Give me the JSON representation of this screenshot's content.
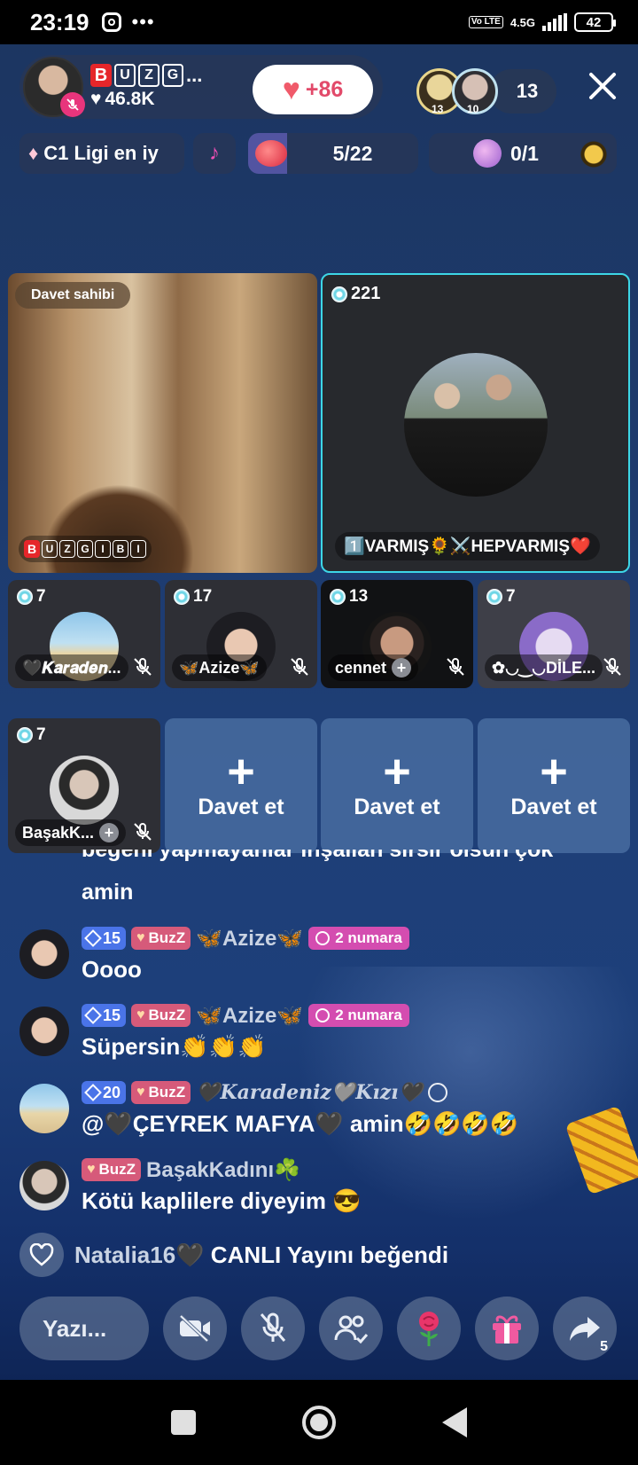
{
  "status_bar": {
    "time": "23:19",
    "network": "4.5G",
    "volte": "Vo LTE",
    "battery": "42"
  },
  "header": {
    "host_letters": [
      "B",
      "U",
      "Z",
      "G"
    ],
    "host_name_ellipsis": "...",
    "host_likes": "46.8K",
    "likes_delta": "+86",
    "viewer_ranks": [
      "13",
      "10"
    ],
    "viewer_count": "13",
    "league": "C1 Ligi en iy",
    "goal_progress": "5/22",
    "goal_fraction": 0.227,
    "box_progress": "0/1"
  },
  "grid": {
    "host_label": "Davet sahibi",
    "host_tile_letters": [
      "B",
      "U",
      "Z",
      "G",
      "I",
      "B",
      "I"
    ],
    "main_guest": {
      "coins": "221",
      "name": "1️⃣VARMIŞ🌻⚔️HEPVARMIŞ❤️"
    },
    "guests": [
      {
        "coins": "7",
        "name": "🖤𝑲𝒂𝒓𝒂𝒅𝒆𝒏..."
      },
      {
        "coins": "17",
        "name": "🦋Azize🦋"
      },
      {
        "coins": "13",
        "name": "cennet"
      },
      {
        "coins": "7",
        "name": "✿◡‿◡DİLE..."
      },
      {
        "coins": "7",
        "name": "BaşakK..."
      }
    ],
    "invite_label": "Davet et",
    "invite_plus": "+"
  },
  "chat": {
    "partial_line": "beğeni yapmayanlar inşallah sirsir olsun çok",
    "partial_line2": "amin",
    "messages": [
      {
        "level": "15",
        "buzz": "BuzZ",
        "user": "🦋Azize🦋",
        "rank": "2 numara",
        "text": "Oooo"
      },
      {
        "level": "15",
        "buzz": "BuzZ",
        "user": "🦋Azize🦋",
        "rank": "2 numara",
        "text": "Süpersin👏👏👏"
      },
      {
        "level": "20",
        "buzz": "BuzZ",
        "user": "🖤Karadeniz🩶Kızı🖤",
        "text": "@🖤ÇEYREK MAFYA🖤 amin🤣🤣🤣🤣"
      },
      {
        "buzz": "BuzZ",
        "user": "BaşakKadını☘️",
        "text": "Kötü kaplilere diyeyim 😎"
      }
    ],
    "liked_user": "Natalia16🖤",
    "liked_text": "CANLI Yayını beğendi"
  },
  "bottom_bar": {
    "input_placeholder": "Yazı...",
    "share_count": "5"
  },
  "colors": {
    "accent_pink": "#e8357c",
    "level_blue": "#4a74e8",
    "buzz_pink": "#d65a7a",
    "rank_magenta": "#d44db0",
    "active_tile_border": "#3dd6e6"
  },
  "icons": {
    "close": "close-icon",
    "mic_off": "mic-off-icon",
    "camera_off": "camera-off-icon",
    "guests": "guests-icon",
    "rose": "rose-icon",
    "gift": "gift-icon",
    "share": "share-icon",
    "heart": "heart-icon"
  }
}
